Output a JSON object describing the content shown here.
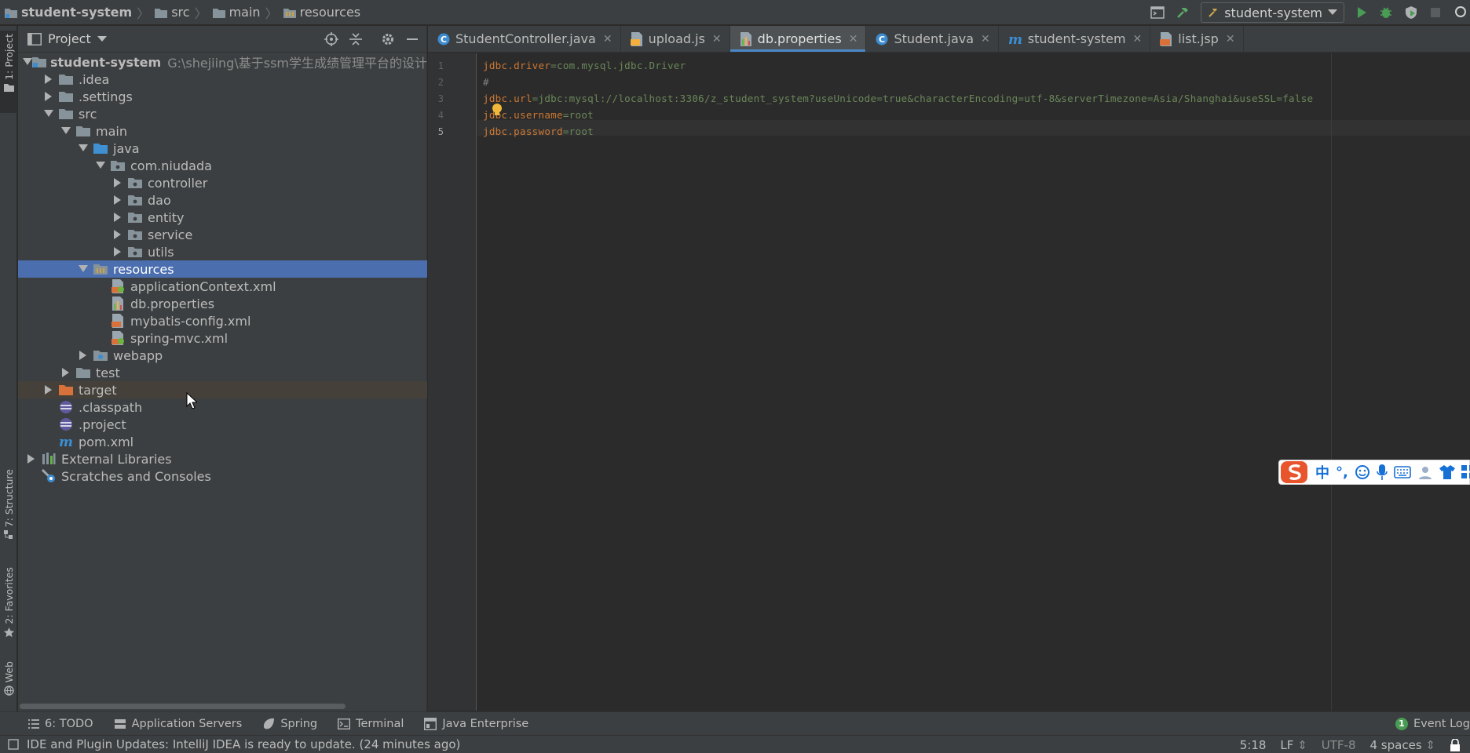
{
  "breadcrumb": {
    "items": [
      "student-system",
      "src",
      "main",
      "resources"
    ]
  },
  "run": {
    "config_name": "student-system"
  },
  "left_stripe": {
    "tabs": [
      "1: Project",
      "7: Structure",
      "2: Favorites",
      "Web"
    ]
  },
  "project_panel": {
    "title": "Project",
    "tree": [
      {
        "label": "student-system",
        "path": "G:\\shejiing\\基于ssm学生成绩管理平台的设计与实现",
        "level": 0,
        "arrow": "down",
        "icon": "module-folder-icon",
        "bold": true
      },
      {
        "label": ".idea",
        "level": 1,
        "arrow": "right",
        "icon": "folder-icon"
      },
      {
        "label": ".settings",
        "level": 1,
        "arrow": "right",
        "icon": "folder-icon"
      },
      {
        "label": "src",
        "level": 1,
        "arrow": "down",
        "icon": "folder-icon"
      },
      {
        "label": "main",
        "level": 2,
        "arrow": "down",
        "icon": "folder-icon"
      },
      {
        "label": "java",
        "level": 3,
        "arrow": "down",
        "icon": "source-folder-icon"
      },
      {
        "label": "com.niudada",
        "level": 4,
        "arrow": "down",
        "icon": "package-icon"
      },
      {
        "label": "controller",
        "level": 5,
        "arrow": "right",
        "icon": "package-icon"
      },
      {
        "label": "dao",
        "level": 5,
        "arrow": "right",
        "icon": "package-icon"
      },
      {
        "label": "entity",
        "level": 5,
        "arrow": "right",
        "icon": "package-icon"
      },
      {
        "label": "service",
        "level": 5,
        "arrow": "right",
        "icon": "package-icon"
      },
      {
        "label": "utils",
        "level": 5,
        "arrow": "right",
        "icon": "package-icon"
      },
      {
        "label": "resources",
        "level": 3,
        "arrow": "down",
        "icon": "resources-folder-icon",
        "selected": true
      },
      {
        "label": "applicationContext.xml",
        "level": 4,
        "arrow": "none",
        "icon": "spring-xml-icon"
      },
      {
        "label": "db.properties",
        "level": 4,
        "arrow": "none",
        "icon": "properties-file-icon"
      },
      {
        "label": "mybatis-config.xml",
        "level": 4,
        "arrow": "none",
        "icon": "xml-file-icon"
      },
      {
        "label": "spring-mvc.xml",
        "level": 4,
        "arrow": "none",
        "icon": "spring-xml-icon"
      },
      {
        "label": "webapp",
        "level": 3,
        "arrow": "right",
        "icon": "web-folder-icon"
      },
      {
        "label": "test",
        "level": 2,
        "arrow": "right",
        "icon": "folder-icon"
      },
      {
        "label": "target",
        "level": 1,
        "arrow": "right",
        "icon": "excluded-folder-icon",
        "excluded": true
      },
      {
        "label": ".classpath",
        "level": 1,
        "arrow": "none",
        "icon": "eclipse-file-icon"
      },
      {
        "label": ".project",
        "level": 1,
        "arrow": "none",
        "icon": "eclipse-file-icon"
      },
      {
        "label": "pom.xml",
        "level": 1,
        "arrow": "none",
        "icon": "maven-icon"
      },
      {
        "label": "External Libraries",
        "level": 0,
        "arrow": "right",
        "icon": "libraries-icon"
      },
      {
        "label": "Scratches and Consoles",
        "level": 0,
        "arrow": "none",
        "icon": "scratches-icon"
      }
    ]
  },
  "editor_tabs": [
    {
      "label": "StudentController.java",
      "icon": "java-class-icon",
      "active": false
    },
    {
      "label": "upload.js",
      "icon": "js-file-icon",
      "active": false
    },
    {
      "label": "db.properties",
      "icon": "properties-file-icon",
      "active": true
    },
    {
      "label": "Student.java",
      "icon": "java-class-icon",
      "active": false
    },
    {
      "label": "student-system",
      "icon": "maven-icon",
      "active": false
    },
    {
      "label": "list.jsp",
      "icon": "jsp-file-icon",
      "active": false
    }
  ],
  "editor": {
    "line_numbers": [
      "1",
      "2",
      "3",
      "4",
      "5"
    ],
    "lines": [
      {
        "key": "jdbc.driver",
        "eq": "=",
        "value": "com.mysql.jdbc.Driver"
      },
      {
        "comment": "#"
      },
      {
        "key": "jdbc.url",
        "eq": "=",
        "value": "jdbc:mysql://localhost:3306/z_student_system?useUnicode=true&characterEncoding=utf-8&serverTimezone=Asia/Shanghai&useSSL=false"
      },
      {
        "key": "jdbc.username",
        "eq": "=",
        "value": "root"
      },
      {
        "key": "jdbc.password",
        "eq": "=",
        "value": "root"
      }
    ]
  },
  "ime": {
    "mode": "中",
    "punct": "°,"
  },
  "tool_windows": [
    {
      "label": "6: TODO",
      "icon": "todo-icon"
    },
    {
      "label": "Application Servers",
      "icon": "app-servers-icon"
    },
    {
      "label": "Spring",
      "icon": "spring-icon"
    },
    {
      "label": "Terminal",
      "icon": "terminal-icon"
    },
    {
      "label": "Java Enterprise",
      "icon": "java-enterprise-icon"
    }
  ],
  "event_log": {
    "label": "Event Log",
    "count": "1"
  },
  "status": {
    "message": "IDE and Plugin Updates: IntelliJ IDEA is ready to update. (24 minutes ago)",
    "position": "5:18",
    "line_sep": "LF",
    "encoding": "UTF-8",
    "indent": "4 spaces"
  },
  "colors": {
    "selection": "#4b6eaf",
    "panel_bg": "#3c3f41",
    "editor_bg": "#2b2b2b",
    "key_orange": "#cc7832",
    "value_green": "#6a8759"
  }
}
